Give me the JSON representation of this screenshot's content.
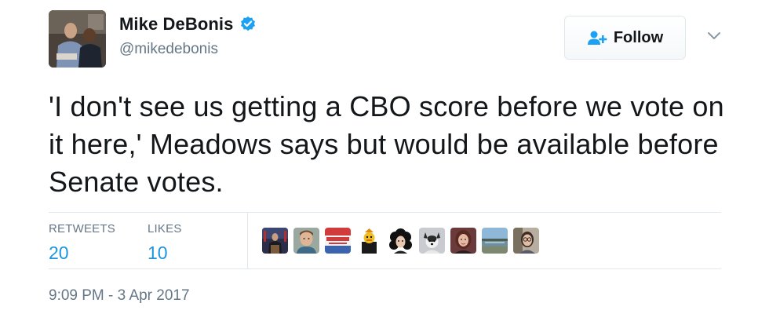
{
  "author": {
    "display_name": "Mike DeBonis",
    "handle": "@mikedebonis",
    "verified": true,
    "avatar_icon": "profile-photo"
  },
  "follow_button": {
    "label": "Follow",
    "icon": "follow-person-plus-icon"
  },
  "menu_icon": "chevron-down-icon",
  "tweet_text": "'I don't see us getting a CBO score before we vote on it here,' Meadows says but would be available before Senate votes.",
  "stats": {
    "retweets": {
      "label": "RETWEETS",
      "value": "20"
    },
    "likes": {
      "label": "LIKES",
      "value": "10"
    }
  },
  "likers": [
    {
      "icon": "liker-avatar-podium"
    },
    {
      "icon": "liker-avatar-man"
    },
    {
      "icon": "liker-avatar-sign"
    },
    {
      "icon": "liker-avatar-duck"
    },
    {
      "icon": "liker-avatar-curly-hair"
    },
    {
      "icon": "liker-avatar-dog"
    },
    {
      "icon": "liker-avatar-woman"
    },
    {
      "icon": "liker-avatar-landscape"
    },
    {
      "icon": "liker-avatar-glasses"
    }
  ],
  "timestamp": "9:09 PM - 3 Apr 2017",
  "colors": {
    "link_blue": "#1b95e0",
    "muted_gray": "#657786",
    "verified_blue": "#1da1f2",
    "border": "#e1e8ed"
  }
}
